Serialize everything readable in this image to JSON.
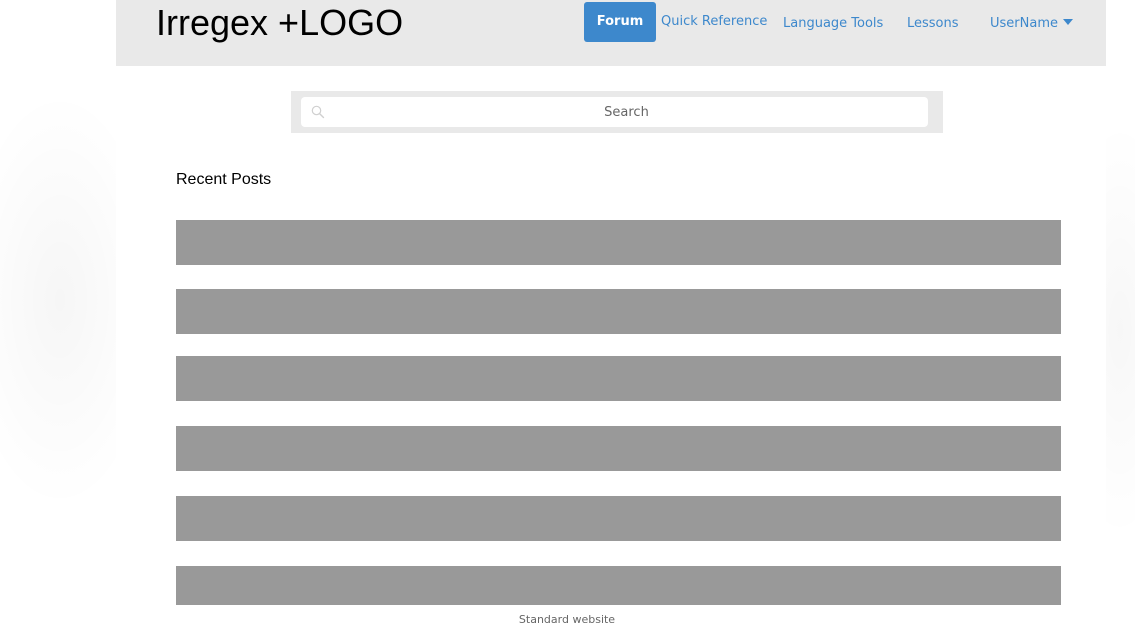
{
  "header": {
    "logo": "Irregex +LOGO",
    "nav": {
      "forum": "Forum",
      "quick_reference": "Quick Reference",
      "language_tools": "Language Tools",
      "lessons": "Lessons",
      "user": "UserName"
    }
  },
  "search": {
    "placeholder": "Search",
    "value": ""
  },
  "recent_posts": {
    "title": "Recent Posts",
    "count": 6
  },
  "footer": {
    "text": "Standard website"
  },
  "colors": {
    "header_bg": "#e9e9e9",
    "accent": "#3d88cc",
    "post_placeholder": "#999999"
  }
}
